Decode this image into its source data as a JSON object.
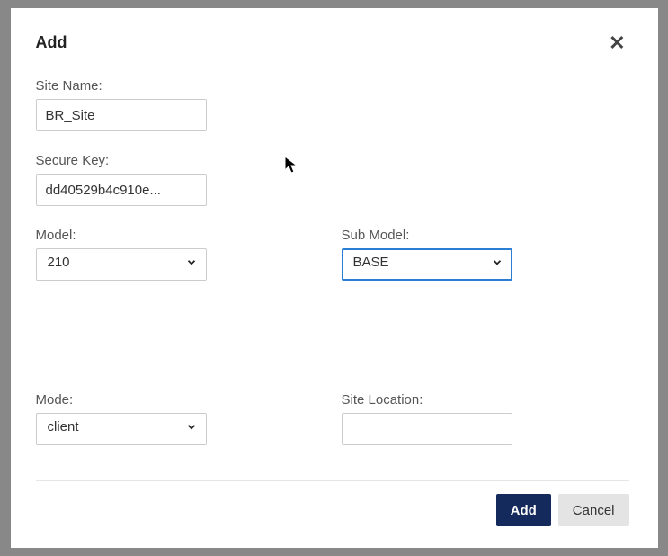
{
  "modal": {
    "title": "Add"
  },
  "fields": {
    "site_name": {
      "label": "Site Name:",
      "value": "BR_Site"
    },
    "secure_key": {
      "label": "Secure Key:",
      "value": "dd40529b4c910e..."
    },
    "model": {
      "label": "Model:",
      "value": "210"
    },
    "sub_model": {
      "label": "Sub Model:",
      "value": "BASE"
    },
    "mode": {
      "label": "Mode:",
      "value": "client"
    },
    "site_location": {
      "label": "Site Location:",
      "value": ""
    }
  },
  "buttons": {
    "add": "Add",
    "cancel": "Cancel"
  }
}
